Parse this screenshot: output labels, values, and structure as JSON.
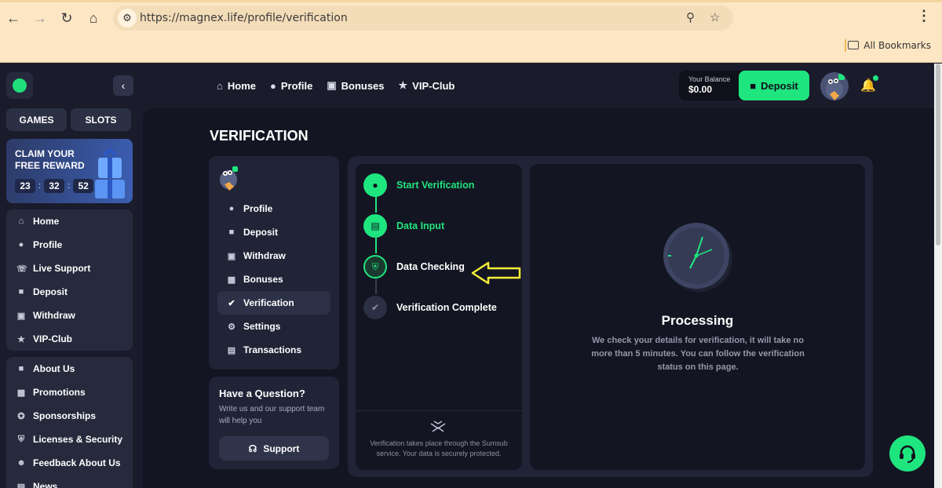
{
  "browser": {
    "url": "https://magnex.life/profile/verification",
    "bookmarks_label": "All Bookmarks"
  },
  "topnav": [
    {
      "label": "Home",
      "icon": "home-icon"
    },
    {
      "label": "Profile",
      "icon": "user-icon"
    },
    {
      "label": "Bonuses",
      "icon": "gift-icon"
    },
    {
      "label": "VIP-Club",
      "icon": "star-icon"
    }
  ],
  "header": {
    "balance_label": "Your Balance",
    "balance_value": "$0.00",
    "deposit_label": "Deposit"
  },
  "sidebar": {
    "tabs": [
      "GAMES",
      "SLOTS"
    ],
    "promo": {
      "title": "CLAIM YOUR FREE REWARD",
      "timer": [
        "23",
        "32",
        "52"
      ]
    },
    "main_items": [
      {
        "label": "Home",
        "icon": "home-icon"
      },
      {
        "label": "Profile",
        "icon": "user-icon"
      },
      {
        "label": "Live Support",
        "icon": "support-icon"
      },
      {
        "label": "Deposit",
        "icon": "wallet-icon"
      },
      {
        "label": "Withdraw",
        "icon": "withdraw-icon"
      },
      {
        "label": "VIP-Club",
        "icon": "star-icon"
      }
    ],
    "info_items": [
      {
        "label": "About Us",
        "icon": "info-icon"
      },
      {
        "label": "Promotions",
        "icon": "promo-icon"
      },
      {
        "label": "Sponsorships",
        "icon": "sponsor-icon"
      },
      {
        "label": "Licenses & Security",
        "icon": "shield-icon"
      },
      {
        "label": "Feedback About Us",
        "icon": "feedback-icon"
      },
      {
        "label": "News",
        "icon": "news-icon"
      }
    ]
  },
  "page_title": "VERIFICATION",
  "profile_menu": [
    {
      "label": "Profile",
      "icon": "user-icon"
    },
    {
      "label": "Deposit",
      "icon": "wallet-icon"
    },
    {
      "label": "Withdraw",
      "icon": "withdraw-icon"
    },
    {
      "label": "Bonuses",
      "icon": "gift-icon"
    },
    {
      "label": "Verification",
      "icon": "check-badge-icon",
      "active": true
    },
    {
      "label": "Settings",
      "icon": "gear-icon"
    },
    {
      "label": "Transactions",
      "icon": "transactions-icon"
    }
  ],
  "question": {
    "title": "Have a Question?",
    "text": "Write us and our support team will help you",
    "button": "Support"
  },
  "steps": [
    {
      "label": "Start Verification",
      "state": "done"
    },
    {
      "label": "Data Input",
      "state": "done"
    },
    {
      "label": "Data Checking",
      "state": "current"
    },
    {
      "label": "Verification Complete",
      "state": "pending"
    }
  ],
  "sumsub_note": "Verification takes place through the Sumsub service. Your data is securely protected.",
  "processing": {
    "title": "Processing",
    "text": "We check your details for verification, it will take no more than 5 minutes. You can follow the verification status on this page."
  },
  "colors": {
    "accent": "#1fe57f",
    "annotation_arrow": "#f5ef3b"
  }
}
